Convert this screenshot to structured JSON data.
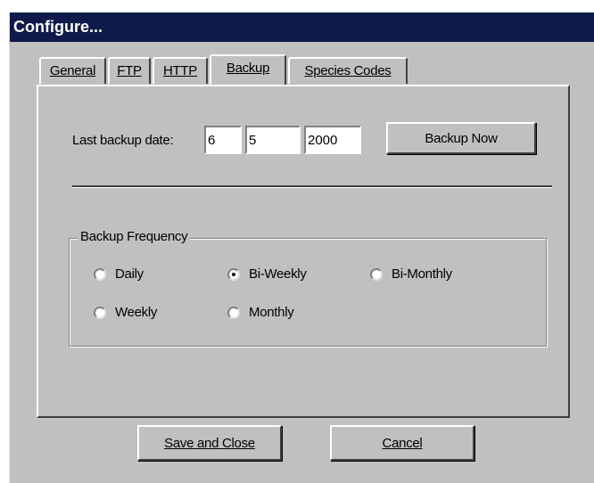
{
  "window": {
    "title": "Configure..."
  },
  "tabs": [
    {
      "label": "General",
      "active": false
    },
    {
      "label": "FTP",
      "active": false
    },
    {
      "label": "HTTP",
      "active": false
    },
    {
      "label": "Backup",
      "active": true
    },
    {
      "label": "Species Codes",
      "active": false
    }
  ],
  "backup": {
    "last_backup_label": "Last backup date:",
    "month": "6",
    "day": "5",
    "year": "2000",
    "backup_now_label": "Backup Now"
  },
  "frequency": {
    "title": "Backup Frequency",
    "selected": "Bi-Weekly",
    "options": [
      "Daily",
      "Bi-Weekly",
      "Bi-Monthly",
      "Weekly",
      "Monthly"
    ]
  },
  "footer": {
    "save_label": "Save and Close",
    "cancel_label": "Cancel"
  }
}
